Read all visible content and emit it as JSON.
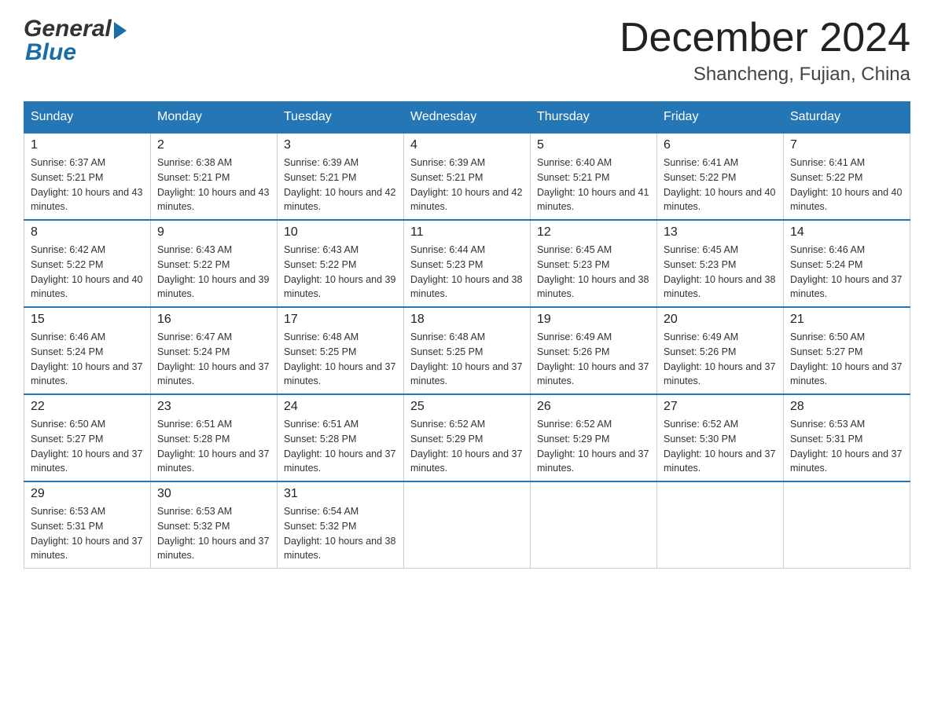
{
  "header": {
    "logo_general": "General",
    "logo_blue": "Blue",
    "month_year": "December 2024",
    "location": "Shancheng, Fujian, China"
  },
  "days_of_week": [
    "Sunday",
    "Monday",
    "Tuesday",
    "Wednesday",
    "Thursday",
    "Friday",
    "Saturday"
  ],
  "weeks": [
    [
      {
        "day": "1",
        "sunrise": "6:37 AM",
        "sunset": "5:21 PM",
        "daylight": "10 hours and 43 minutes."
      },
      {
        "day": "2",
        "sunrise": "6:38 AM",
        "sunset": "5:21 PM",
        "daylight": "10 hours and 43 minutes."
      },
      {
        "day": "3",
        "sunrise": "6:39 AM",
        "sunset": "5:21 PM",
        "daylight": "10 hours and 42 minutes."
      },
      {
        "day": "4",
        "sunrise": "6:39 AM",
        "sunset": "5:21 PM",
        "daylight": "10 hours and 42 minutes."
      },
      {
        "day": "5",
        "sunrise": "6:40 AM",
        "sunset": "5:21 PM",
        "daylight": "10 hours and 41 minutes."
      },
      {
        "day": "6",
        "sunrise": "6:41 AM",
        "sunset": "5:22 PM",
        "daylight": "10 hours and 40 minutes."
      },
      {
        "day": "7",
        "sunrise": "6:41 AM",
        "sunset": "5:22 PM",
        "daylight": "10 hours and 40 minutes."
      }
    ],
    [
      {
        "day": "8",
        "sunrise": "6:42 AM",
        "sunset": "5:22 PM",
        "daylight": "10 hours and 40 minutes."
      },
      {
        "day": "9",
        "sunrise": "6:43 AM",
        "sunset": "5:22 PM",
        "daylight": "10 hours and 39 minutes."
      },
      {
        "day": "10",
        "sunrise": "6:43 AM",
        "sunset": "5:22 PM",
        "daylight": "10 hours and 39 minutes."
      },
      {
        "day": "11",
        "sunrise": "6:44 AM",
        "sunset": "5:23 PM",
        "daylight": "10 hours and 38 minutes."
      },
      {
        "day": "12",
        "sunrise": "6:45 AM",
        "sunset": "5:23 PM",
        "daylight": "10 hours and 38 minutes."
      },
      {
        "day": "13",
        "sunrise": "6:45 AM",
        "sunset": "5:23 PM",
        "daylight": "10 hours and 38 minutes."
      },
      {
        "day": "14",
        "sunrise": "6:46 AM",
        "sunset": "5:24 PM",
        "daylight": "10 hours and 37 minutes."
      }
    ],
    [
      {
        "day": "15",
        "sunrise": "6:46 AM",
        "sunset": "5:24 PM",
        "daylight": "10 hours and 37 minutes."
      },
      {
        "day": "16",
        "sunrise": "6:47 AM",
        "sunset": "5:24 PM",
        "daylight": "10 hours and 37 minutes."
      },
      {
        "day": "17",
        "sunrise": "6:48 AM",
        "sunset": "5:25 PM",
        "daylight": "10 hours and 37 minutes."
      },
      {
        "day": "18",
        "sunrise": "6:48 AM",
        "sunset": "5:25 PM",
        "daylight": "10 hours and 37 minutes."
      },
      {
        "day": "19",
        "sunrise": "6:49 AM",
        "sunset": "5:26 PM",
        "daylight": "10 hours and 37 minutes."
      },
      {
        "day": "20",
        "sunrise": "6:49 AM",
        "sunset": "5:26 PM",
        "daylight": "10 hours and 37 minutes."
      },
      {
        "day": "21",
        "sunrise": "6:50 AM",
        "sunset": "5:27 PM",
        "daylight": "10 hours and 37 minutes."
      }
    ],
    [
      {
        "day": "22",
        "sunrise": "6:50 AM",
        "sunset": "5:27 PM",
        "daylight": "10 hours and 37 minutes."
      },
      {
        "day": "23",
        "sunrise": "6:51 AM",
        "sunset": "5:28 PM",
        "daylight": "10 hours and 37 minutes."
      },
      {
        "day": "24",
        "sunrise": "6:51 AM",
        "sunset": "5:28 PM",
        "daylight": "10 hours and 37 minutes."
      },
      {
        "day": "25",
        "sunrise": "6:52 AM",
        "sunset": "5:29 PM",
        "daylight": "10 hours and 37 minutes."
      },
      {
        "day": "26",
        "sunrise": "6:52 AM",
        "sunset": "5:29 PM",
        "daylight": "10 hours and 37 minutes."
      },
      {
        "day": "27",
        "sunrise": "6:52 AM",
        "sunset": "5:30 PM",
        "daylight": "10 hours and 37 minutes."
      },
      {
        "day": "28",
        "sunrise": "6:53 AM",
        "sunset": "5:31 PM",
        "daylight": "10 hours and 37 minutes."
      }
    ],
    [
      {
        "day": "29",
        "sunrise": "6:53 AM",
        "sunset": "5:31 PM",
        "daylight": "10 hours and 37 minutes."
      },
      {
        "day": "30",
        "sunrise": "6:53 AM",
        "sunset": "5:32 PM",
        "daylight": "10 hours and 37 minutes."
      },
      {
        "day": "31",
        "sunrise": "6:54 AM",
        "sunset": "5:32 PM",
        "daylight": "10 hours and 38 minutes."
      },
      null,
      null,
      null,
      null
    ]
  ]
}
